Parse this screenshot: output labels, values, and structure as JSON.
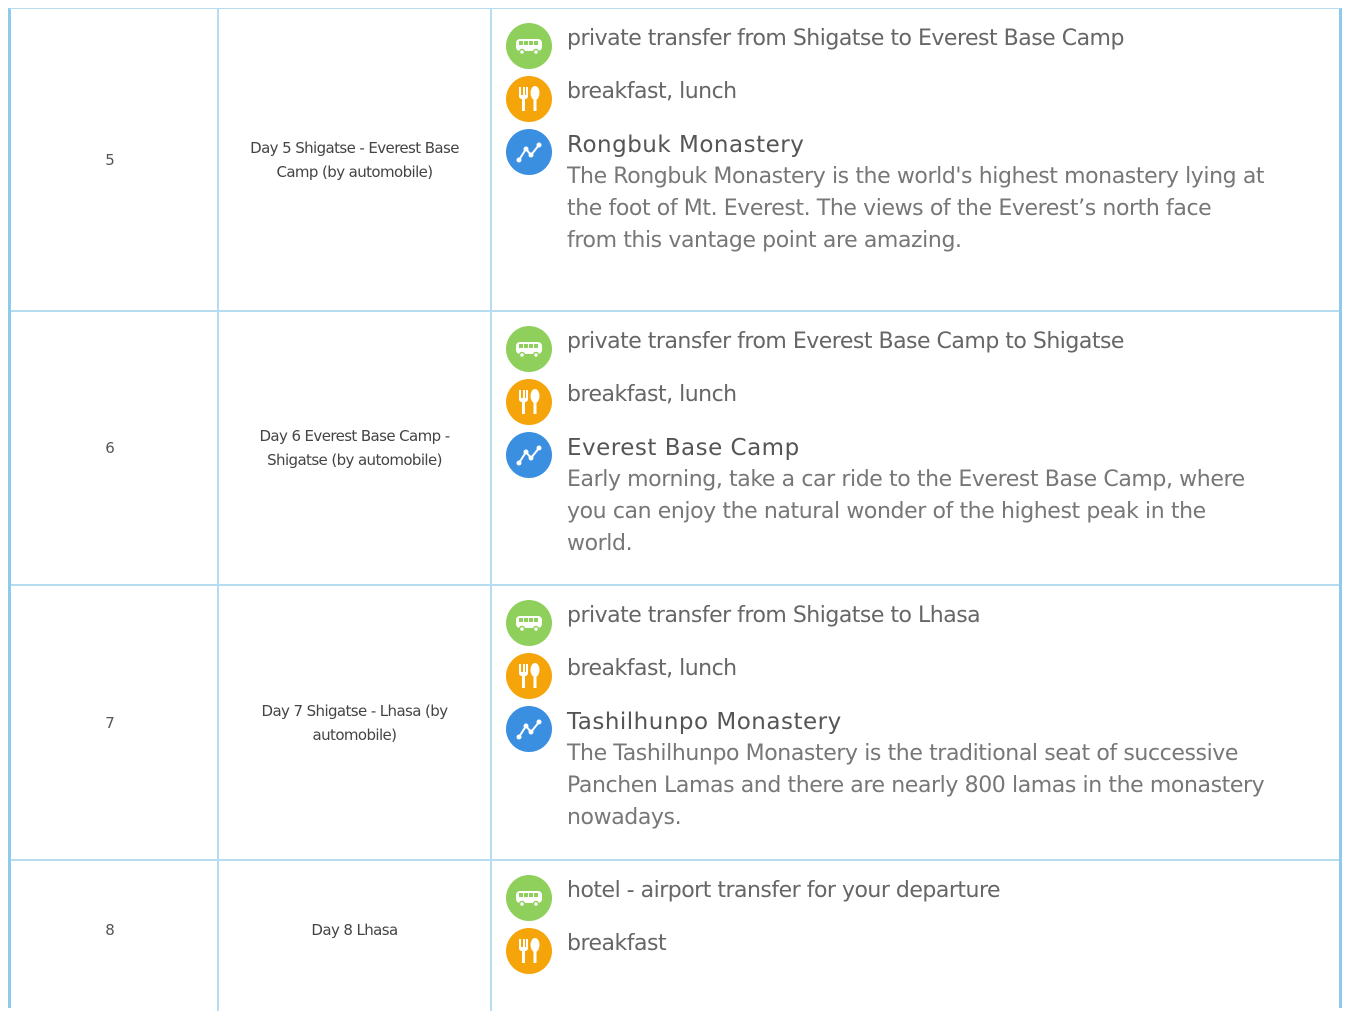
{
  "rows": [
    {
      "num": "5",
      "day": "Day 5 Shigatse - Everest Base Camp (by automobile)",
      "transfer": "private transfer from Shigatse to Everest Base Camp",
      "meals": "breakfast, lunch",
      "attraction_title": "Rongbuk Monastery",
      "attraction_desc": "The Rongbuk Monastery is the world's highest monastery lying at the foot of Mt. Everest. The views of the Everest’s north face from this vantage point are amazing."
    },
    {
      "num": "6",
      "day": "Day 6 Everest Base Camp - Shigatse (by automobile)",
      "transfer": "private transfer from Everest Base Camp to Shigatse",
      "meals": "breakfast, lunch",
      "attraction_title": "Everest Base Camp",
      "attraction_desc": "Early morning, take a car ride to the Everest Base Camp, where you can enjoy the natural wonder of the highest peak in the world."
    },
    {
      "num": "7",
      "day": "Day 7 Shigatse - Lhasa (by automobile)",
      "transfer": "private transfer from Shigatse to Lhasa",
      "meals": "breakfast, lunch",
      "attraction_title": "Tashilhunpo Monastery",
      "attraction_desc": "The Tashilhunpo Monastery is the traditional seat of successive Panchen Lamas and there are nearly 800 lamas in the monastery nowadays."
    },
    {
      "num": "8",
      "day": "Day 8 Lhasa",
      "transfer": "hotel - airport transfer for your departure",
      "meals": "breakfast"
    }
  ],
  "icons": {
    "transfer": "bus-icon",
    "meals": "fork-knife-icon",
    "attraction": "route-icon"
  },
  "colors": {
    "border": "#b7dcef",
    "outer_border": "#8ccbea",
    "transfer_icon": "#8fcf5c",
    "meal_icon": "#f5a40a",
    "attraction_icon": "#3b8fe0"
  }
}
